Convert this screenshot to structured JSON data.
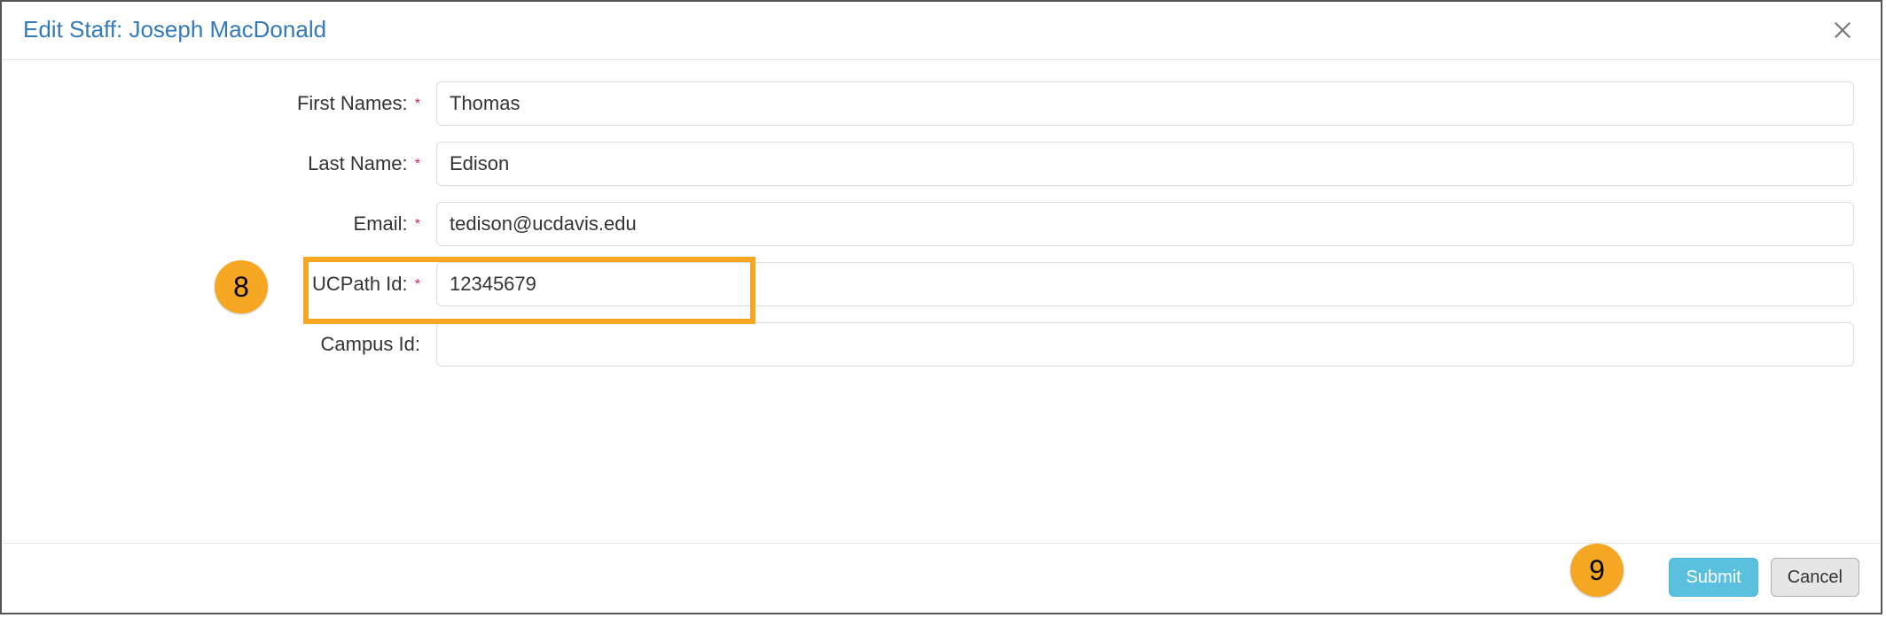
{
  "modal": {
    "title": "Edit Staff: Joseph MacDonald"
  },
  "form": {
    "first_names": {
      "label": "First Names:",
      "required": true,
      "value": "Thomas"
    },
    "last_name": {
      "label": "Last Name:",
      "required": true,
      "value": "Edison"
    },
    "email": {
      "label": "Email:",
      "required": true,
      "value": "tedison@ucdavis.edu"
    },
    "ucpath_id": {
      "label": "UCPath Id:",
      "required": true,
      "value": "12345679"
    },
    "campus_id": {
      "label": "Campus Id:",
      "required": false,
      "value": ""
    }
  },
  "required_marker": "*",
  "footer": {
    "submit": "Submit",
    "cancel": "Cancel"
  },
  "annotations": {
    "step8": "8",
    "step9": "9"
  }
}
